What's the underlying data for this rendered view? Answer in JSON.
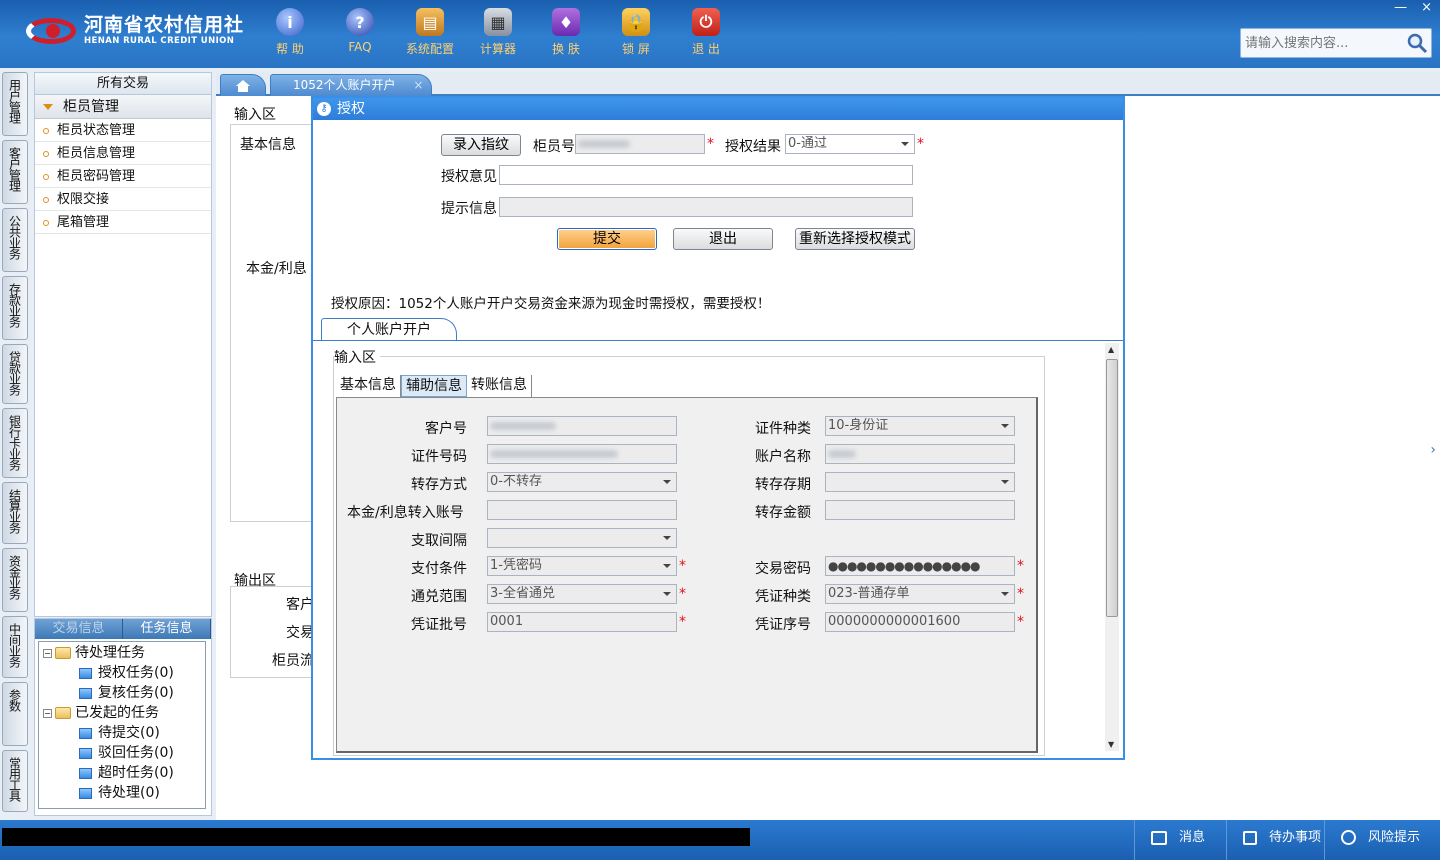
{
  "app": {
    "logo_cn": "河南省农村信用社",
    "logo_en": "HENAN RURAL CREDIT UNION",
    "colors": {
      "top": "#2a74c4",
      "accent": "#3a8ee6",
      "tool_label": "#ffd070",
      "required": "#e0101e"
    },
    "toolbar": [
      {
        "label": "帮 助",
        "icon": "info-icon"
      },
      {
        "label": "FAQ",
        "icon": "question-icon"
      },
      {
        "label": "系统配置",
        "icon": "toolbox-icon"
      },
      {
        "label": "计算器",
        "icon": "calculator-icon"
      },
      {
        "label": "换 肤",
        "icon": "shirt-icon"
      },
      {
        "label": "锁 屏",
        "icon": "lock-icon"
      },
      {
        "label": "退 出",
        "icon": "power-icon"
      }
    ],
    "window_controls": {
      "minimize": "—",
      "close": "×"
    },
    "search_placeholder": "请输入搜索内容..."
  },
  "vtabs": [
    "用户管理",
    "客户管理",
    "公共业务",
    "存款业务",
    "贷款业务",
    "银行卡业务",
    "结算业务",
    "资金业务",
    "中间业务",
    "参数",
    "常用工具"
  ],
  "leftpanel": {
    "header": "所有交易",
    "group": "柜员管理",
    "items": [
      "柜员状态管理",
      "柜员信息管理",
      "柜员密码管理",
      "权限交接",
      "尾箱管理"
    ]
  },
  "taskpanel": {
    "tabs": [
      "交易信息",
      "任务信息"
    ],
    "tree": {
      "pending": "待处理任务",
      "pending_children": [
        "授权任务(0)",
        "复核任务(0)"
      ],
      "initiated": "已发起的任务",
      "initiated_children": [
        "待提交(0)",
        "驳回任务(0)",
        "超时任务(0)",
        "待处理(0)"
      ]
    }
  },
  "main": {
    "tab_title": "1052个人账户开户",
    "bg": {
      "input_legend": "输入区",
      "tab_basic": "基本信息",
      "principal": "本金/利息",
      "output_legend": "输出区",
      "cust": "客户",
      "trans": "交易",
      "teller": "柜员流"
    }
  },
  "dialog": {
    "title": "授权",
    "fingerprint_button": "录入指纹",
    "teller_label": "柜员号",
    "result_label": "授权结果",
    "result_value": "0-通过",
    "opinion_label": "授权意见",
    "hint_label": "提示信息",
    "submit": "提交",
    "exit": "退出",
    "reselect": "重新选择授权模式",
    "reason": "授权原因：1052个人账户开户交易资金来源为现金时需授权，需要授权！",
    "subtab": "个人账户开户",
    "input_legend": "输入区",
    "inner_tabs": [
      "基本信息",
      "辅助信息",
      "转账信息"
    ],
    "fields": {
      "cust_no": "客户号",
      "id_type": "证件种类",
      "id_type_value": "10-身份证",
      "id_no": "证件号码",
      "acct_name": "账户名称",
      "transfer_mode": "转存方式",
      "transfer_mode_value": "0-不转存",
      "transfer_term": "转存存期",
      "principal_acct": "本金/利息转入账号",
      "transfer_amount": "转存金额",
      "interval": "支取间隔",
      "pay_cond": "支付条件",
      "pay_cond_value": "1-凭密码",
      "trans_pwd": "交易密码",
      "trans_pwd_value": "●●●●●●●●●●●●●●●●",
      "scope": "通兑范围",
      "scope_value": "3-全省通兑",
      "voucher_type": "凭证种类",
      "voucher_type_value": "023-普通存单",
      "voucher_batch": "凭证批号",
      "voucher_batch_value": "0001",
      "voucher_seq": "凭证序号",
      "voucher_seq_value": "0000000000001600",
      "required_mark": "*"
    }
  },
  "statusbar": {
    "messages": "消息",
    "todo": "待办事项",
    "risk": "风险提示"
  }
}
